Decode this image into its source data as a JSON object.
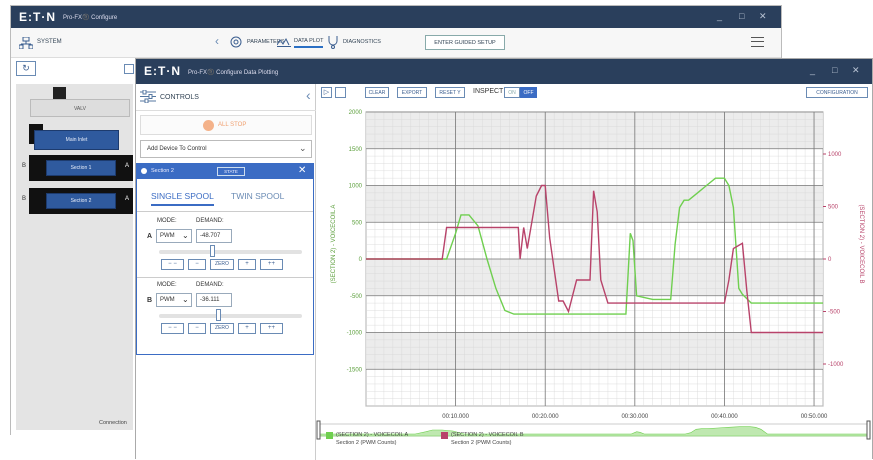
{
  "back_window": {
    "logo": "E:T·N",
    "title": "Pro-FX®️ Configure",
    "nav": {
      "system_label": "SYSTEM",
      "parameters_label": "PARAMETERS",
      "data_plot_label": "DATA PLOT",
      "diagnostics_label": "DIAGNOSTICS",
      "guided_setup_label": "ENTER GUIDED SETUP"
    },
    "devices": {
      "valve_label": "VALV",
      "main_inlet_label": "Main Inlet",
      "section1_label": "Section 1",
      "section2_label": "Section 2",
      "letter_a": "A",
      "letter_b": "B"
    },
    "status_label": "Connection"
  },
  "front_window": {
    "logo": "E:T·N",
    "title": "Pro-FX®️ Configure Data Plotting",
    "controls": {
      "header": "CONTROLS",
      "all_stop_label": "ALL STOP",
      "add_device_value": "Add Device To Control",
      "card_title": "Section 2",
      "card_status": "STATE",
      "tab_single": "SINGLE SPOOL",
      "tab_twin": "TWIN SPOOL",
      "spool_a": {
        "letter": "A",
        "mode_label": "MODE:",
        "demand_label": "DEMAND:",
        "mode_value": "PWM",
        "demand_value": "-48.707",
        "slider_level": 0.38
      },
      "spool_b": {
        "letter": "B",
        "mode_label": "MODE:",
        "demand_label": "DEMAND:",
        "mode_value": "PWM",
        "demand_value": "-36.111",
        "slider_level": 0.42
      },
      "step_buttons": [
        "− −",
        "−",
        "ZERO",
        "+",
        "++"
      ]
    },
    "toolbar": {
      "clear": "CLEAR",
      "export": "EXPORT",
      "reset_y": "RESET Y",
      "inspect": "INSPECT",
      "on": "ON",
      "off": "OFF",
      "configuration": "CONFIGURATION"
    },
    "legend": [
      {
        "line1": "(SECTION 2) - VOICECOIL A",
        "line2": "Section 2 (PWM Counts)",
        "color": "#6fcf4f"
      },
      {
        "line1": "(SECTION 2) - VOICECOIL B",
        "line2": "Section 2 (PWM Counts)",
        "color": "#b8436a"
      }
    ]
  },
  "chart_data": {
    "type": "line",
    "xlabel": "",
    "x_ticks": [
      "00:10.000",
      "00:20.000",
      "00:30.000",
      "00:40.000",
      "00:50.000"
    ],
    "x_range": [
      0,
      51
    ],
    "ylabel_left": "(SECTION 2) - VOICECOIL A",
    "ylabel_right": "(SECTION 2) - VOICECOIL B",
    "ylim_left": [
      -2000,
      2000
    ],
    "yticks_left": [
      2000,
      1500,
      1000,
      500,
      0,
      -500,
      -1000,
      -1500
    ],
    "ylim_right": [
      -1400,
      1400
    ],
    "yticks_right": [
      1000,
      500,
      0,
      -500,
      -1000
    ],
    "grid": true,
    "series": [
      {
        "name": "(SECTION 2) - VOICECOIL A",
        "color": "#6fcf4f",
        "axis": "left",
        "x": [
          0,
          8.5,
          9,
          10,
          10.6,
          11.5,
          12.5,
          13.5,
          14.5,
          15.5,
          16.5,
          29,
          29.5,
          29.8,
          30.2,
          32,
          34,
          34.5,
          35,
          35.5,
          36,
          37,
          38,
          39,
          40,
          40.5,
          41,
          41.6,
          42,
          43,
          51
        ],
        "values": [
          0,
          0,
          0,
          350,
          600,
          600,
          450,
          0,
          -400,
          -700,
          -750,
          -750,
          350,
          250,
          -500,
          -550,
          -550,
          200,
          700,
          800,
          800,
          900,
          1000,
          1100,
          1100,
          1000,
          700,
          -400,
          -480,
          -600,
          -600
        ]
      },
      {
        "name": "(SECTION 2) - VOICECOIL B",
        "color": "#b8436a",
        "axis": "right",
        "x": [
          0,
          8.5,
          9,
          17,
          17.2,
          17.6,
          18,
          19,
          19.6,
          20,
          20.5,
          21.5,
          22,
          22.6,
          23.5,
          25,
          25.4,
          25.8,
          26.2,
          27,
          40,
          40.5,
          41,
          42,
          42.5,
          43,
          43.5,
          51
        ],
        "values": [
          0,
          0,
          300,
          300,
          0,
          300,
          100,
          600,
          700,
          700,
          200,
          -400,
          -400,
          -500,
          -200,
          -200,
          650,
          450,
          -200,
          -420,
          -420,
          -200,
          100,
          150,
          -300,
          -700,
          -700,
          -700
        ]
      }
    ]
  }
}
